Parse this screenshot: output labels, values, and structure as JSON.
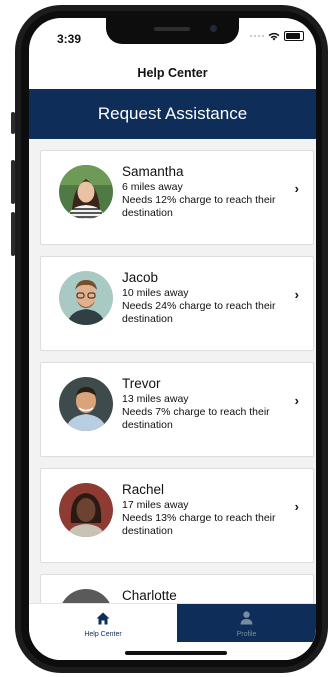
{
  "status_bar": {
    "time": "3:39"
  },
  "header": {
    "nav_title": "Help Center",
    "banner_title": "Request Assistance"
  },
  "requests": [
    {
      "name": "Samantha",
      "distance": "6 miles away",
      "need": "Needs 12% charge to reach their destination"
    },
    {
      "name": "Jacob",
      "distance": "10 miles away",
      "need": "Needs 24% charge to reach their destination"
    },
    {
      "name": "Trevor",
      "distance": "13 miles away",
      "need": "Needs 7% charge to reach their destination"
    },
    {
      "name": "Rachel",
      "distance": "17 miles away",
      "need": "Needs 13% charge to reach their destination"
    },
    {
      "name": "Charlotte"
    }
  ],
  "tab_bar": {
    "tabs": [
      {
        "label": "Help Center",
        "icon": "home-icon",
        "selected": true
      },
      {
        "label": "Profile",
        "icon": "person-icon",
        "selected": false
      }
    ]
  },
  "colors": {
    "brand_navy": "#0e2d59",
    "list_bg": "#f2f2f2"
  }
}
